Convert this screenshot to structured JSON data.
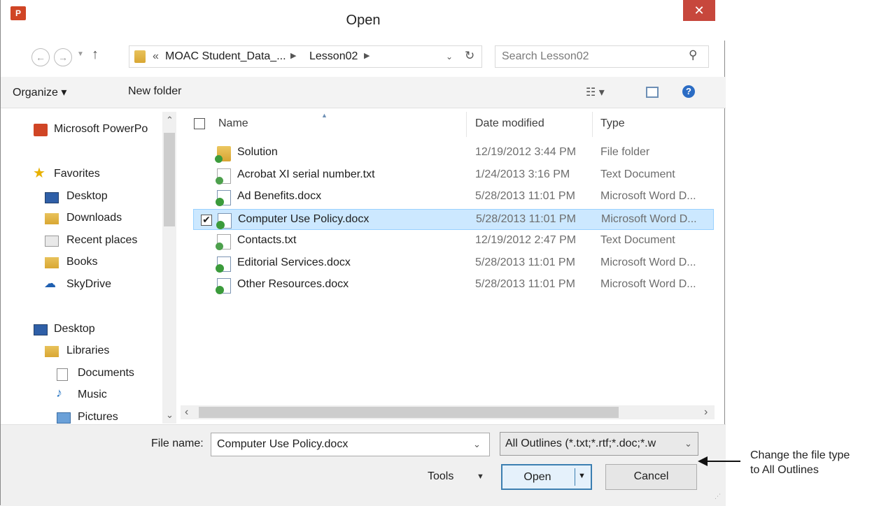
{
  "window": {
    "title": "Open",
    "app_icon_label": "P"
  },
  "address": {
    "overflow": "«",
    "crumbs": [
      "MOAC Student_Data_...",
      "Lesson02"
    ],
    "search_placeholder": "Search Lesson02"
  },
  "toolbar": {
    "organize": "Organize ▾",
    "new_folder": "New folder"
  },
  "nav": {
    "pinned": "Microsoft PowerPo",
    "favorites_header": "Favorites",
    "favorites": [
      "Desktop",
      "Downloads",
      "Recent places",
      "Books",
      "SkyDrive"
    ],
    "desktop": "Desktop",
    "libraries": "Libraries",
    "library_items": [
      "Documents",
      "Music",
      "Pictures"
    ]
  },
  "columns": {
    "name": "Name",
    "date": "Date modified",
    "type": "Type"
  },
  "files": [
    {
      "name": "Solution",
      "date": "12/19/2012 3:44 PM",
      "type": "File folder",
      "icon": "folder-icon"
    },
    {
      "name": "Acrobat XI serial number.txt",
      "date": "1/24/2013 3:16 PM",
      "type": "Text Document",
      "icon": "text-file-icon"
    },
    {
      "name": "Ad Benefits.docx",
      "date": "5/28/2013 11:01 PM",
      "type": "Microsoft Word D...",
      "icon": "word-doc-icon"
    },
    {
      "name": "Computer Use Policy.docx",
      "date": "5/28/2013 11:01 PM",
      "type": "Microsoft Word D...",
      "icon": "word-doc-icon",
      "selected": true
    },
    {
      "name": "Contacts.txt",
      "date": "12/19/2012 2:47 PM",
      "type": "Text Document",
      "icon": "text-file-icon"
    },
    {
      "name": "Editorial Services.docx",
      "date": "5/28/2013 11:01 PM",
      "type": "Microsoft Word D...",
      "icon": "word-doc-icon"
    },
    {
      "name": "Other Resources.docx",
      "date": "5/28/2013 11:01 PM",
      "type": "Microsoft Word D...",
      "icon": "word-doc-icon"
    }
  ],
  "bottom": {
    "file_name_label": "File name:",
    "file_name_value": "Computer Use Policy.docx",
    "file_type_value": "All Outlines (*.txt;*.rtf;*.doc;*.w",
    "tools": "Tools",
    "open": "Open",
    "cancel": "Cancel"
  },
  "callout": {
    "line1": "Change the file type",
    "line2": "to All Outlines"
  },
  "colors": {
    "selection_bg": "#cce8ff",
    "selection_border": "#99d1ff",
    "close_red": "#c7473c",
    "accent_blue": "#3c7fb1"
  }
}
